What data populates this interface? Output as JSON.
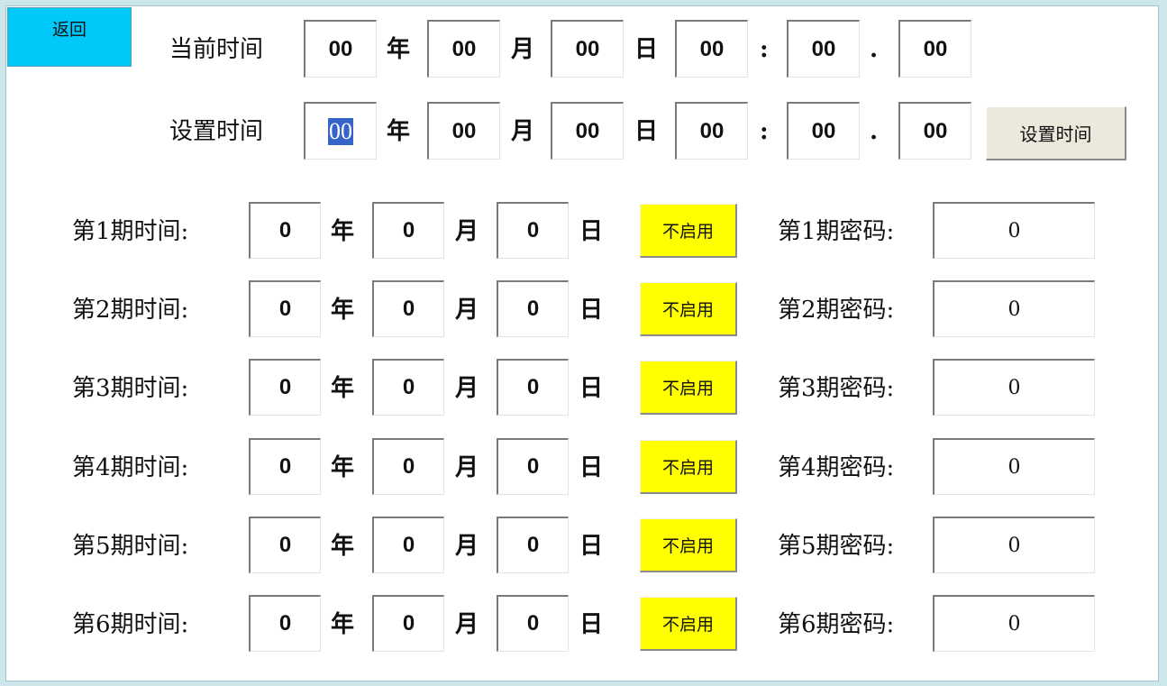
{
  "back_label": "返回",
  "current_time": {
    "label": "当前时间",
    "year": "00",
    "month": "00",
    "day": "00",
    "hour": "00",
    "minute": "00",
    "second": "00"
  },
  "set_time": {
    "label": "设置时间",
    "year": "00",
    "month": "00",
    "day": "00",
    "hour": "00",
    "minute": "00",
    "second": "00",
    "button_label": "设置时间"
  },
  "units": {
    "year": "年",
    "month": "月",
    "day": "日",
    "colon": ":",
    "dot": "."
  },
  "periods": [
    {
      "label": "第1期时间:",
      "year": "0",
      "month": "0",
      "day": "0",
      "toggle": "不启用",
      "pw_label": "第1期密码:",
      "password": "0"
    },
    {
      "label": "第2期时间:",
      "year": "0",
      "month": "0",
      "day": "0",
      "toggle": "不启用",
      "pw_label": "第2期密码:",
      "password": "0"
    },
    {
      "label": "第3期时间:",
      "year": "0",
      "month": "0",
      "day": "0",
      "toggle": "不启用",
      "pw_label": "第3期密码:",
      "password": "0"
    },
    {
      "label": "第4期时间:",
      "year": "0",
      "month": "0",
      "day": "0",
      "toggle": "不启用",
      "pw_label": "第4期密码:",
      "password": "0"
    },
    {
      "label": "第5期时间:",
      "year": "0",
      "month": "0",
      "day": "0",
      "toggle": "不启用",
      "pw_label": "第5期密码:",
      "password": "0"
    },
    {
      "label": "第6期时间:",
      "year": "0",
      "month": "0",
      "day": "0",
      "toggle": "不启用",
      "pw_label": "第6期密码:",
      "password": "0"
    }
  ],
  "colors": {
    "back_button": "#00c8f8",
    "toggle_button": "#ffff00",
    "set_button": "#ebe8dc",
    "selection": "#3565c8"
  }
}
